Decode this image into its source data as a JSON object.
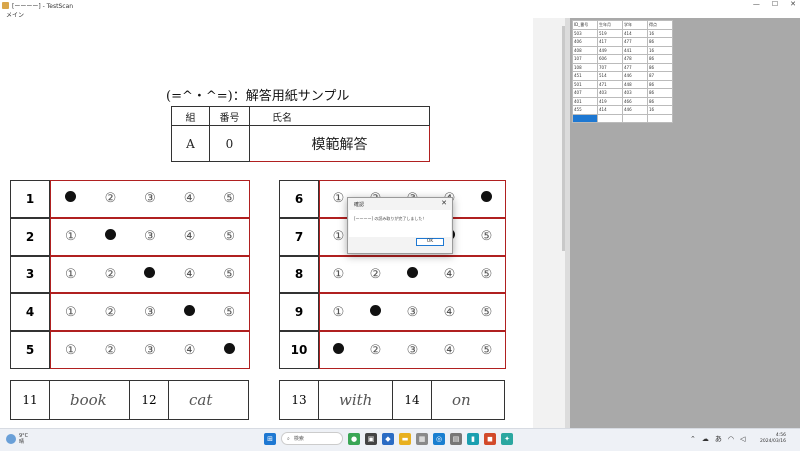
{
  "window": {
    "title": "[ーーーー] - TestScan",
    "menu": "メイン",
    "controls": {
      "minimize": "—",
      "maximize": "☐",
      "close": "✕"
    }
  },
  "document": {
    "title": "(=^・^=)：解答用紙サンプル",
    "header": {
      "labels": [
        "組",
        "番号",
        "氏名"
      ],
      "values": [
        "A",
        "0",
        "模範解答"
      ]
    },
    "choice_glyphs": [
      "①",
      "②",
      "③",
      "④",
      "⑤"
    ],
    "left_questions": [
      {
        "number": "1",
        "selected": 1
      },
      {
        "number": "2",
        "selected": 2
      },
      {
        "number": "3",
        "selected": 3
      },
      {
        "number": "4",
        "selected": 4
      },
      {
        "number": "5",
        "selected": 5
      }
    ],
    "right_questions": [
      {
        "number": "6",
        "selected": 5
      },
      {
        "number": "7",
        "selected": 4
      },
      {
        "number": "8",
        "selected": 3
      },
      {
        "number": "9",
        "selected": 2
      },
      {
        "number": "10",
        "selected": 1
      }
    ],
    "written_answers": [
      {
        "number": "11",
        "answer": "book"
      },
      {
        "number": "12",
        "answer": "cat"
      },
      {
        "number": "13",
        "answer": "with"
      },
      {
        "number": "14",
        "answer": "on"
      }
    ]
  },
  "sheet": {
    "headers": [
      "ID_番号",
      "生年月",
      "学年",
      "得点"
    ],
    "rows": [
      [
        "503",
        "519",
        "414",
        "16"
      ],
      [
        "406",
        "417",
        "477",
        "86"
      ],
      [
        "408",
        "449",
        "441",
        "16"
      ],
      [
        "107",
        "606",
        "478",
        "86"
      ],
      [
        "108",
        "707",
        "477",
        "86"
      ],
      [
        "451",
        "514",
        "446",
        "87"
      ],
      [
        "501",
        "471",
        "448",
        "86"
      ],
      [
        "407",
        "403",
        "403",
        "86"
      ],
      [
        "401",
        "419",
        "466",
        "86"
      ],
      [
        "455",
        "414",
        "446",
        "16"
      ],
      [
        "",
        "",
        "",
        ""
      ]
    ]
  },
  "dialog": {
    "title": "確認",
    "close": "✕",
    "message": "[ーーーー] の読み取りが完了しました！",
    "ok_label": "OK"
  },
  "taskbar": {
    "weather_temp": "9°C",
    "weather_desc": "晴",
    "search_placeholder": "検索",
    "clock_time": "4:56",
    "clock_date": "2024/03/16",
    "tray_label": "あ",
    "colors": {
      "start": "#1e78d2",
      "selection": "#1e78d2",
      "answer_border": "#b02020"
    }
  }
}
